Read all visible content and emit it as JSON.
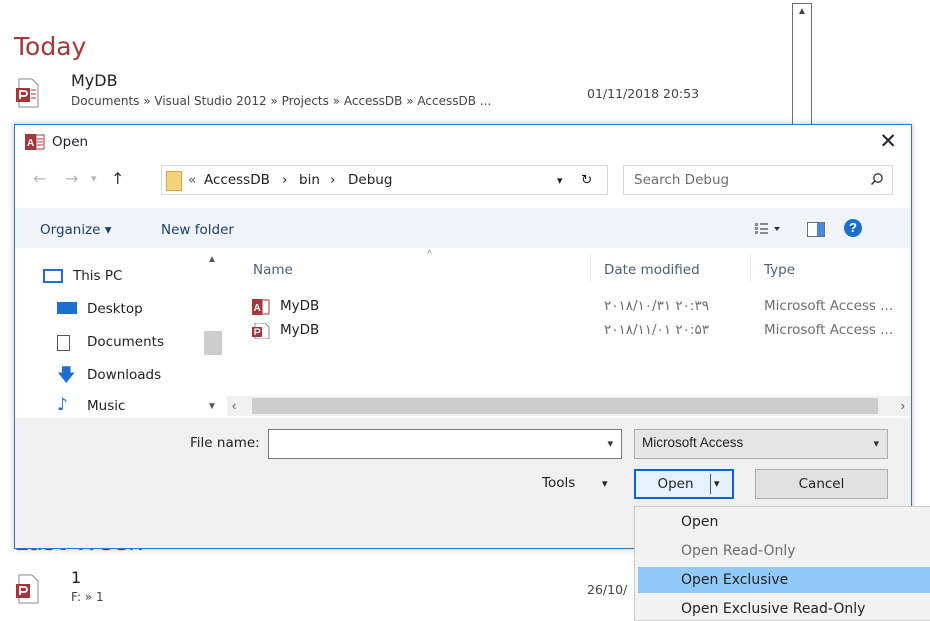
{
  "recent": {
    "groups": [
      {
        "title": "Today",
        "items": [
          {
            "name": "MyDB",
            "path": "Documents » Visual Studio 2012 » Projects » AccessDB » AccessDB ...",
            "date": "01/11/2018 20:53"
          }
        ]
      },
      {
        "title": "Last Week",
        "items": [
          {
            "name": "1",
            "path": "F: » 1",
            "date": "26/10/"
          }
        ]
      }
    ]
  },
  "dialog": {
    "title": "Open",
    "address": [
      "«",
      "AccessDB",
      "›",
      "bin",
      "›",
      "Debug"
    ],
    "search_placeholder": "Search Debug",
    "toolbar": {
      "organize": "Organize ▾",
      "new_folder": "New folder"
    },
    "nav_items": [
      {
        "label": "This PC",
        "icon": "pc-icon"
      },
      {
        "label": "Desktop",
        "icon": "desktop-icon"
      },
      {
        "label": "Documents",
        "icon": "documents-icon"
      },
      {
        "label": "Downloads",
        "icon": "downloads-icon"
      },
      {
        "label": "Music",
        "icon": "music-icon"
      }
    ],
    "columns": [
      "Name",
      "Date modified",
      "Type"
    ],
    "files": [
      {
        "name": "MyDB",
        "date": "۲۰۱۸/۱۰/۳۱ ۲۰:۳۹",
        "type": "Microsoft Access ..."
      },
      {
        "name": "MyDB",
        "date": "۲۰۱۸/۱۱/۰۱ ۲۰:۵۳",
        "type": "Microsoft Access ..."
      }
    ],
    "file_name_label": "File name:",
    "file_name_value": "",
    "file_type": "Microsoft Access",
    "tools_label": "Tools",
    "open_label": "Open",
    "cancel_label": "Cancel"
  },
  "menu": {
    "items": [
      {
        "label": "Open",
        "disabled": false,
        "highlighted": false
      },
      {
        "label": "Open Read-Only",
        "disabled": true,
        "highlighted": false
      },
      {
        "label": "Open Exclusive",
        "disabled": false,
        "highlighted": true
      },
      {
        "label": "Open Exclusive Read-Only",
        "disabled": false,
        "highlighted": false
      }
    ]
  },
  "colors": {
    "accent": "#a4373a",
    "selection": "#91c9f7",
    "link_blue": "#1e3e68"
  }
}
